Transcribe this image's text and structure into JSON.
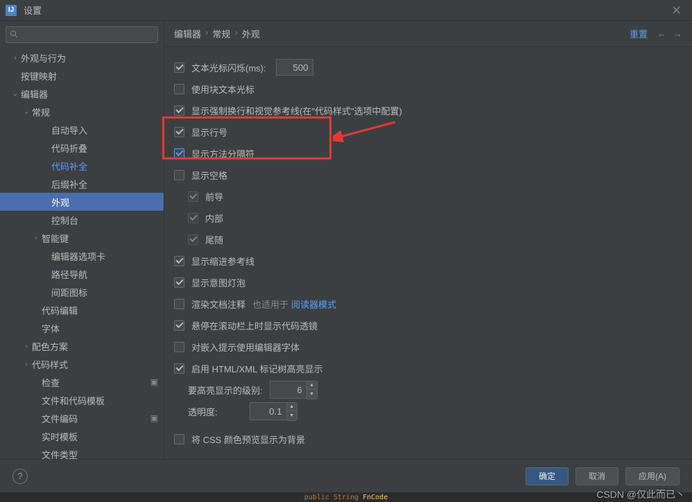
{
  "titlebar": {
    "app_icon": "IJ",
    "title": "设置"
  },
  "search": {
    "placeholder": ""
  },
  "sidebar": {
    "items": [
      {
        "label": "外观与行为",
        "arrow": "›",
        "pad": 1
      },
      {
        "label": "按键映射",
        "arrow": "",
        "pad": 1
      },
      {
        "label": "编辑器",
        "arrow": "⌄",
        "pad": 1
      },
      {
        "label": "常规",
        "arrow": "⌄",
        "pad": 2
      },
      {
        "label": "自动导入",
        "arrow": "",
        "pad": 4
      },
      {
        "label": "代码折叠",
        "arrow": "",
        "pad": 4
      },
      {
        "label": "代码补全",
        "arrow": "",
        "pad": 4,
        "blue": true
      },
      {
        "label": "后缀补全",
        "arrow": "",
        "pad": 4
      },
      {
        "label": "外观",
        "arrow": "",
        "pad": 4,
        "selected": true
      },
      {
        "label": "控制台",
        "arrow": "",
        "pad": 4
      },
      {
        "label": "智能键",
        "arrow": "›",
        "pad": 3
      },
      {
        "label": "编辑器选项卡",
        "arrow": "",
        "pad": 4
      },
      {
        "label": "路径导航",
        "arrow": "",
        "pad": 4
      },
      {
        "label": "间距图标",
        "arrow": "",
        "pad": 4
      },
      {
        "label": "代码编辑",
        "arrow": "",
        "pad": 3
      },
      {
        "label": "字体",
        "arrow": "",
        "pad": 3
      },
      {
        "label": "配色方案",
        "arrow": "›",
        "pad": 2
      },
      {
        "label": "代码样式",
        "arrow": "›",
        "pad": 2
      },
      {
        "label": "检查",
        "arrow": "",
        "pad": 3,
        "gear": true
      },
      {
        "label": "文件和代码模板",
        "arrow": "",
        "pad": 3
      },
      {
        "label": "文件编码",
        "arrow": "",
        "pad": 3,
        "gear": true
      },
      {
        "label": "实时模板",
        "arrow": "",
        "pad": 3
      },
      {
        "label": "文件类型",
        "arrow": "",
        "pad": 3
      }
    ]
  },
  "breadcrumb": {
    "a": "编辑器",
    "b": "常规",
    "c": "外观"
  },
  "reset": "重置",
  "settings": {
    "cursor_blink_label": "文本光标闪烁(ms):",
    "cursor_blink_value": "500",
    "block_cursor": "使用块文本光标",
    "hard_wrap": "显示强制换行和视觉参考线(在\"代码样式\"选项中配置)",
    "line_numbers": "显示行号",
    "method_separators": "显示方法分隔符",
    "show_whitespace": "显示空格",
    "ws_leading": "前导",
    "ws_inner": "内部",
    "ws_trailing": "尾随",
    "indent_guides": "显示缩进参考线",
    "intention_bulb": "显示意图灯泡",
    "render_doc": "渲染文档注释",
    "reader_mode_prefix": "也适用于",
    "reader_mode_link": "阅读器模式",
    "code_lens": "悬停在滚动栏上时显示代码透镜",
    "editor_font_hint": "对嵌入提示使用编辑器字体",
    "html_xml_highlight": "启用 HTML/XML 标记树高亮显示",
    "highlight_level_label": "要高亮显示的级别:",
    "highlight_level_value": "6",
    "transparency_label": "透明度:",
    "transparency_value": "0.1",
    "css_preview_bg": "将 CSS 颜色预览显示为背景"
  },
  "footer": {
    "ok": "确定",
    "cancel": "取消",
    "apply": "应用(A)"
  },
  "watermark": "CSDN @仅此而已丶",
  "code_strip": {
    "pub": "public",
    "str": "String",
    "fn": "FnCode"
  }
}
